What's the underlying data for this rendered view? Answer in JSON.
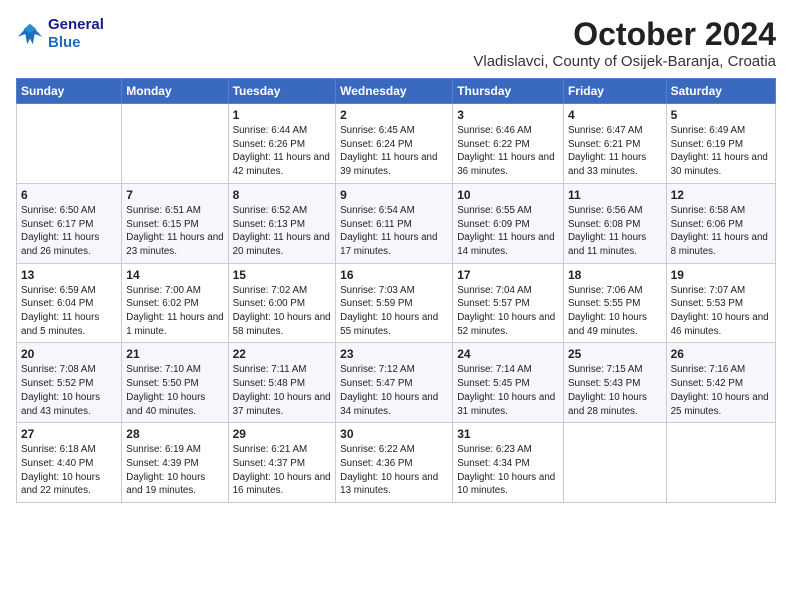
{
  "header": {
    "logo_line1": "General",
    "logo_line2": "Blue",
    "month": "October 2024",
    "location": "Vladislavci, County of Osijek-Baranja, Croatia"
  },
  "weekdays": [
    "Sunday",
    "Monday",
    "Tuesday",
    "Wednesday",
    "Thursday",
    "Friday",
    "Saturday"
  ],
  "weeks": [
    [
      {
        "day": "",
        "sunrise": "",
        "sunset": "",
        "daylight": ""
      },
      {
        "day": "",
        "sunrise": "",
        "sunset": "",
        "daylight": ""
      },
      {
        "day": "1",
        "sunrise": "Sunrise: 6:44 AM",
        "sunset": "Sunset: 6:26 PM",
        "daylight": "Daylight: 11 hours and 42 minutes."
      },
      {
        "day": "2",
        "sunrise": "Sunrise: 6:45 AM",
        "sunset": "Sunset: 6:24 PM",
        "daylight": "Daylight: 11 hours and 39 minutes."
      },
      {
        "day": "3",
        "sunrise": "Sunrise: 6:46 AM",
        "sunset": "Sunset: 6:22 PM",
        "daylight": "Daylight: 11 hours and 36 minutes."
      },
      {
        "day": "4",
        "sunrise": "Sunrise: 6:47 AM",
        "sunset": "Sunset: 6:21 PM",
        "daylight": "Daylight: 11 hours and 33 minutes."
      },
      {
        "day": "5",
        "sunrise": "Sunrise: 6:49 AM",
        "sunset": "Sunset: 6:19 PM",
        "daylight": "Daylight: 11 hours and 30 minutes."
      }
    ],
    [
      {
        "day": "6",
        "sunrise": "Sunrise: 6:50 AM",
        "sunset": "Sunset: 6:17 PM",
        "daylight": "Daylight: 11 hours and 26 minutes."
      },
      {
        "day": "7",
        "sunrise": "Sunrise: 6:51 AM",
        "sunset": "Sunset: 6:15 PM",
        "daylight": "Daylight: 11 hours and 23 minutes."
      },
      {
        "day": "8",
        "sunrise": "Sunrise: 6:52 AM",
        "sunset": "Sunset: 6:13 PM",
        "daylight": "Daylight: 11 hours and 20 minutes."
      },
      {
        "day": "9",
        "sunrise": "Sunrise: 6:54 AM",
        "sunset": "Sunset: 6:11 PM",
        "daylight": "Daylight: 11 hours and 17 minutes."
      },
      {
        "day": "10",
        "sunrise": "Sunrise: 6:55 AM",
        "sunset": "Sunset: 6:09 PM",
        "daylight": "Daylight: 11 hours and 14 minutes."
      },
      {
        "day": "11",
        "sunrise": "Sunrise: 6:56 AM",
        "sunset": "Sunset: 6:08 PM",
        "daylight": "Daylight: 11 hours and 11 minutes."
      },
      {
        "day": "12",
        "sunrise": "Sunrise: 6:58 AM",
        "sunset": "Sunset: 6:06 PM",
        "daylight": "Daylight: 11 hours and 8 minutes."
      }
    ],
    [
      {
        "day": "13",
        "sunrise": "Sunrise: 6:59 AM",
        "sunset": "Sunset: 6:04 PM",
        "daylight": "Daylight: 11 hours and 5 minutes."
      },
      {
        "day": "14",
        "sunrise": "Sunrise: 7:00 AM",
        "sunset": "Sunset: 6:02 PM",
        "daylight": "Daylight: 11 hours and 1 minute."
      },
      {
        "day": "15",
        "sunrise": "Sunrise: 7:02 AM",
        "sunset": "Sunset: 6:00 PM",
        "daylight": "Daylight: 10 hours and 58 minutes."
      },
      {
        "day": "16",
        "sunrise": "Sunrise: 7:03 AM",
        "sunset": "Sunset: 5:59 PM",
        "daylight": "Daylight: 10 hours and 55 minutes."
      },
      {
        "day": "17",
        "sunrise": "Sunrise: 7:04 AM",
        "sunset": "Sunset: 5:57 PM",
        "daylight": "Daylight: 10 hours and 52 minutes."
      },
      {
        "day": "18",
        "sunrise": "Sunrise: 7:06 AM",
        "sunset": "Sunset: 5:55 PM",
        "daylight": "Daylight: 10 hours and 49 minutes."
      },
      {
        "day": "19",
        "sunrise": "Sunrise: 7:07 AM",
        "sunset": "Sunset: 5:53 PM",
        "daylight": "Daylight: 10 hours and 46 minutes."
      }
    ],
    [
      {
        "day": "20",
        "sunrise": "Sunrise: 7:08 AM",
        "sunset": "Sunset: 5:52 PM",
        "daylight": "Daylight: 10 hours and 43 minutes."
      },
      {
        "day": "21",
        "sunrise": "Sunrise: 7:10 AM",
        "sunset": "Sunset: 5:50 PM",
        "daylight": "Daylight: 10 hours and 40 minutes."
      },
      {
        "day": "22",
        "sunrise": "Sunrise: 7:11 AM",
        "sunset": "Sunset: 5:48 PM",
        "daylight": "Daylight: 10 hours and 37 minutes."
      },
      {
        "day": "23",
        "sunrise": "Sunrise: 7:12 AM",
        "sunset": "Sunset: 5:47 PM",
        "daylight": "Daylight: 10 hours and 34 minutes."
      },
      {
        "day": "24",
        "sunrise": "Sunrise: 7:14 AM",
        "sunset": "Sunset: 5:45 PM",
        "daylight": "Daylight: 10 hours and 31 minutes."
      },
      {
        "day": "25",
        "sunrise": "Sunrise: 7:15 AM",
        "sunset": "Sunset: 5:43 PM",
        "daylight": "Daylight: 10 hours and 28 minutes."
      },
      {
        "day": "26",
        "sunrise": "Sunrise: 7:16 AM",
        "sunset": "Sunset: 5:42 PM",
        "daylight": "Daylight: 10 hours and 25 minutes."
      }
    ],
    [
      {
        "day": "27",
        "sunrise": "Sunrise: 6:18 AM",
        "sunset": "Sunset: 4:40 PM",
        "daylight": "Daylight: 10 hours and 22 minutes."
      },
      {
        "day": "28",
        "sunrise": "Sunrise: 6:19 AM",
        "sunset": "Sunset: 4:39 PM",
        "daylight": "Daylight: 10 hours and 19 minutes."
      },
      {
        "day": "29",
        "sunrise": "Sunrise: 6:21 AM",
        "sunset": "Sunset: 4:37 PM",
        "daylight": "Daylight: 10 hours and 16 minutes."
      },
      {
        "day": "30",
        "sunrise": "Sunrise: 6:22 AM",
        "sunset": "Sunset: 4:36 PM",
        "daylight": "Daylight: 10 hours and 13 minutes."
      },
      {
        "day": "31",
        "sunrise": "Sunrise: 6:23 AM",
        "sunset": "Sunset: 4:34 PM",
        "daylight": "Daylight: 10 hours and 10 minutes."
      },
      {
        "day": "",
        "sunrise": "",
        "sunset": "",
        "daylight": ""
      },
      {
        "day": "",
        "sunrise": "",
        "sunset": "",
        "daylight": ""
      }
    ]
  ]
}
